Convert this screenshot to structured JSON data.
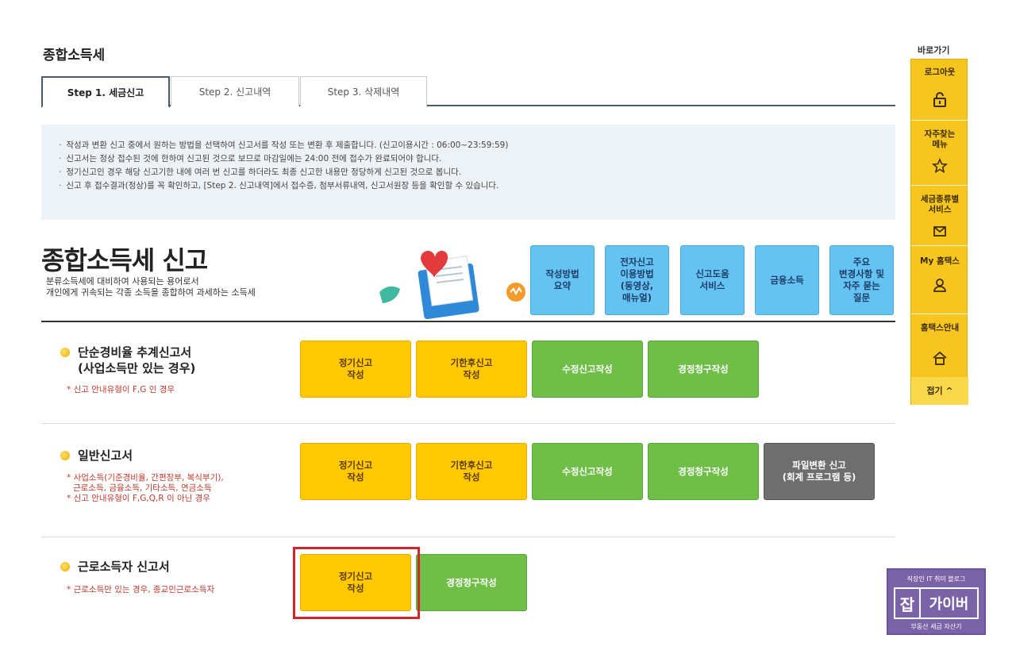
{
  "page": {
    "title": "종합소득세"
  },
  "tabs": [
    {
      "label": "Step 1. 세금신고",
      "active": true
    },
    {
      "label": "Step 2. 신고내역",
      "active": false
    },
    {
      "label": "Step 3. 삭제내역",
      "active": false
    }
  ],
  "notice": [
    "작성과 변환 신고 중에서 원하는 방법을 선택하여 신고서를 작성 또는 변환 후 제출합니다. (신고이용시간 : 06:00~23:59:59)",
    "신고서는 정상 접수된 것에 한하여 신고된 것으로 보므로 마감일에는 24:00 전에 접수가 완료되어야 합니다.",
    "정기신고인 경우 해당 신고기한 내에 여러 번 신고를 하더라도 최종 신고한 내용만 정당하게 신고된 것으로 봅니다.",
    "신고 후 접수결과(정상)를 꼭 확인하고, [Step 2. 신고내역]에서 접수증, 첨부서류내역, 신고서원장 등을 확인할 수 있습니다."
  ],
  "section": {
    "heading": "종합소득세 신고",
    "desc_line1": "분류소득세에 대비하여 사용되는 용어로서",
    "desc_line2": "개인에게 귀속되는 각종 소득을 종합하여 과세하는 소득세"
  },
  "quick_buttons": [
    "작성방법\n요약",
    "전자신고\n이용방법\n(동영상,\n매뉴얼)",
    "신고도움\n서비스",
    "금융소득",
    "주요\n변경사항 및\n자주 묻는\n질문"
  ],
  "forms": [
    {
      "title": "단순경비율 추계신고서\n(사업소득만 있는 경우)",
      "notes": [
        "* 신고 안내유형이 F,G 인 경우"
      ],
      "buttons": [
        {
          "label": "정기신고\n작성",
          "color": "yellow"
        },
        {
          "label": "기한후신고\n작성",
          "color": "yellow"
        },
        {
          "label": "수정신고작성",
          "color": "green"
        },
        {
          "label": "경정청구작성",
          "color": "green"
        }
      ]
    },
    {
      "title": "일반신고서",
      "notes": [
        "* 사업소득(기준경비율, 간편장부, 복식부기),",
        "근로소득, 금융소득, 기타소득, 연금소득",
        "* 신고 안내유형이 F,G,Q,R 이 아닌 경우"
      ],
      "buttons": [
        {
          "label": "정기신고\n작성",
          "color": "yellow"
        },
        {
          "label": "기한후신고\n작성",
          "color": "yellow"
        },
        {
          "label": "수정신고작성",
          "color": "green"
        },
        {
          "label": "경정청구작성",
          "color": "green"
        },
        {
          "label": "파일변환 신고\n(회계 프로그램 등)",
          "color": "gray"
        }
      ]
    },
    {
      "title": "근로소득자 신고서",
      "notes": [
        "* 근로소득만 있는 경우, 종교인근로소득자"
      ],
      "buttons": [
        {
          "label": "정기신고\n작성",
          "color": "yellow"
        },
        {
          "label": "경정청구작성",
          "color": "green"
        }
      ]
    }
  ],
  "quicklinks": {
    "title": "바로가기",
    "items": [
      {
        "label": "로그아웃",
        "icon": "lock-icon"
      },
      {
        "label": "자주찾는\n메뉴",
        "icon": "star-icon"
      },
      {
        "label": "세금종류별\n서비스",
        "icon": "mail-icon"
      },
      {
        "label": "My 홈택스",
        "icon": "user-icon"
      },
      {
        "label": "홈택스안내",
        "icon": "home-icon"
      }
    ],
    "close_label": "접기 ^"
  },
  "watermark": {
    "top": "직장인 IT 취미 블로그",
    "jab": "잡",
    "name": "가이버",
    "bottom": "부동산 세금 자산기"
  },
  "colors": {
    "accent_blue": "#64c3f3",
    "yellow": "#ffc800",
    "green": "#6fbe48",
    "gray": "#6e6e6e",
    "highlight_red": "#d2262b",
    "quicklink_yellow": "#f6c61e"
  }
}
